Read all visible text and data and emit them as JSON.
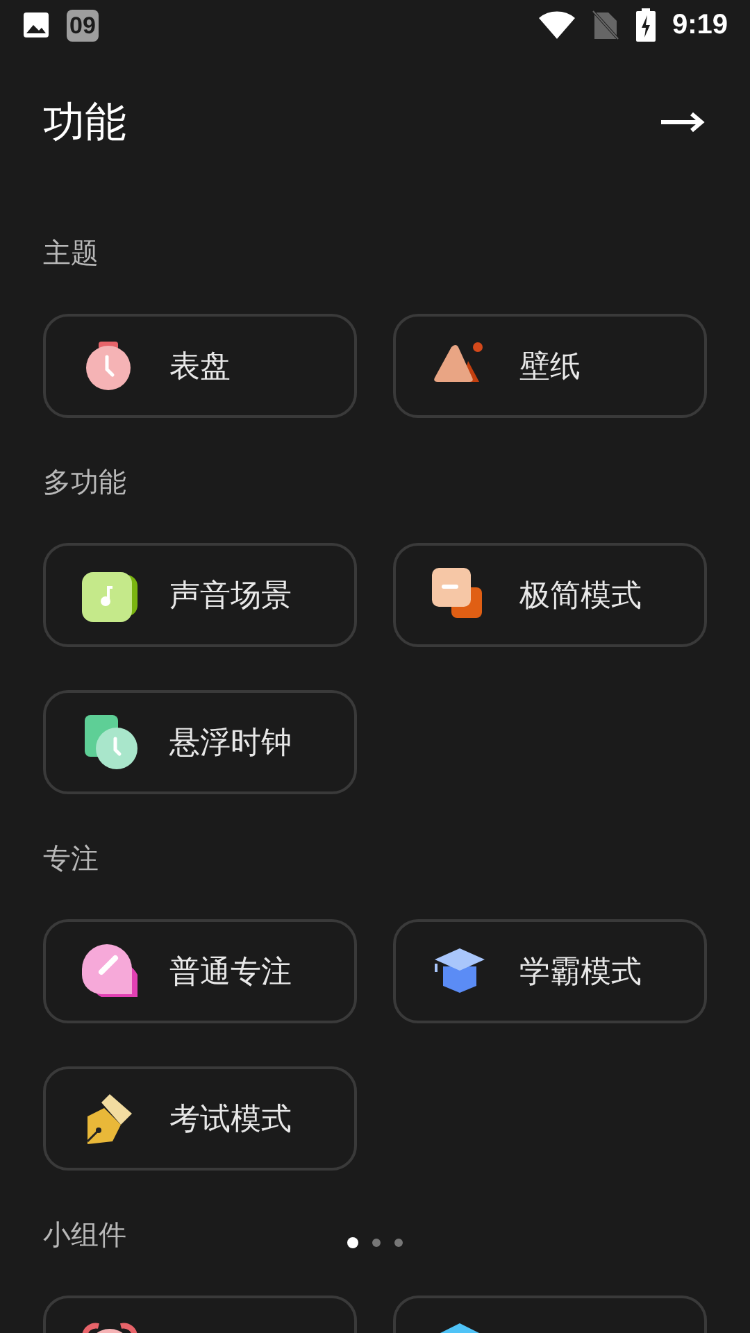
{
  "status_bar": {
    "badge": "09",
    "time": "9:19"
  },
  "header": {
    "title": "功能"
  },
  "sections": [
    {
      "title": "主题",
      "cards": [
        {
          "kind": "watch",
          "label": "表盘"
        },
        {
          "kind": "mountain",
          "label": "壁纸"
        }
      ]
    },
    {
      "title": "多功能",
      "cards": [
        {
          "kind": "music",
          "label": "声音场景"
        },
        {
          "kind": "squares",
          "label": "极简模式"
        },
        {
          "kind": "floatclock",
          "label": "悬浮时钟"
        }
      ]
    },
    {
      "title": "专注",
      "cards": [
        {
          "kind": "bubble",
          "label": "普通专注"
        },
        {
          "kind": "cap",
          "label": "学霸模式"
        },
        {
          "kind": "pen",
          "label": "考试模式"
        }
      ]
    },
    {
      "title": "小组件",
      "pager": [
        {
          "selected": true
        },
        {
          "selected": false
        },
        {
          "selected": false
        }
      ],
      "cards": [
        {
          "kind": "alarm"
        },
        {
          "kind": "cube"
        }
      ]
    }
  ]
}
